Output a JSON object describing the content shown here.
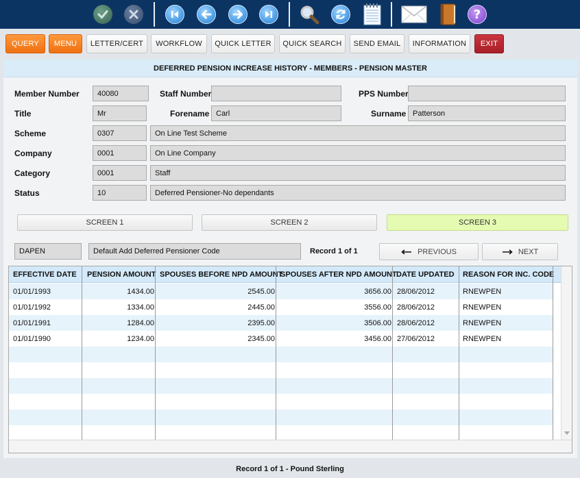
{
  "toolbar": {
    "icons": [
      "confirm-icon",
      "cancel-icon",
      "first-record-icon",
      "previous-record-icon",
      "next-record-icon",
      "last-record-icon",
      "search-icon",
      "refresh-icon",
      "notepad-icon",
      "email-icon",
      "book-icon",
      "help-icon"
    ],
    "help_glyph": "?"
  },
  "buttons": {
    "query": "QUERY",
    "menu": "MENU",
    "letter_cert": "LETTER/CERT",
    "workflow": "WORKFLOW",
    "quick_letter": "QUICK LETTER",
    "quick_search": "QUICK SEARCH",
    "send_email": "SEND EMAIL",
    "information": "INFORMATION",
    "exit": "EXIT"
  },
  "header": {
    "title": "DEFERRED PENSION INCREASE HISTORY - MEMBERS - PENSION MASTER"
  },
  "form": {
    "member_number": {
      "label": "Member Number",
      "value": "40080"
    },
    "staff_number": {
      "label": "Staff Number",
      "value": ""
    },
    "pps_number": {
      "label": "PPS Number",
      "value": ""
    },
    "title": {
      "label": "Title",
      "value": "Mr"
    },
    "forename": {
      "label": "Forename",
      "value": "Carl"
    },
    "surname": {
      "label": "Surname",
      "value": "Patterson"
    },
    "scheme": {
      "label": "Scheme",
      "code": "0307",
      "desc": "On Line Test Scheme"
    },
    "company": {
      "label": "Company",
      "code": "0001",
      "desc": "On Line Company"
    },
    "category": {
      "label": "Category",
      "code": "0001",
      "desc": "Staff"
    },
    "status": {
      "label": "Status",
      "code": "10",
      "desc": "Deferred Pensioner-No dependants"
    }
  },
  "screens": {
    "screen1": "SCREEN 1",
    "screen2": "SCREEN 2",
    "screen3": "SCREEN 3",
    "active": "screen3"
  },
  "pension_code": {
    "code": "DAPEN",
    "desc": "Default Add Deferred Pensioner Code"
  },
  "record_indicator": "Record 1 of 1",
  "nav": {
    "previous": "PREVIOUS",
    "next": "NEXT"
  },
  "table": {
    "columns": [
      "EFFECTIVE DATE",
      "PENSION AMOUNT",
      "SPOUSES BEFORE NPD AMOUNT",
      "SPOUSES AFTER NPD AMOUNT",
      "DATE UPDATED",
      "REASON FOR INC. CODE"
    ],
    "rows": [
      [
        "01/01/1993",
        "1434.00",
        "2545.00",
        "3656.00",
        "28/06/2012",
        "RNEWPEN"
      ],
      [
        "01/01/1992",
        "1334.00",
        "2445.00",
        "3556.00",
        "28/06/2012",
        "RNEWPEN"
      ],
      [
        "01/01/1991",
        "1284.00",
        "2395.00",
        "3506.00",
        "28/06/2012",
        "RNEWPEN"
      ],
      [
        "01/01/1990",
        "1234.00",
        "2345.00",
        "3456.00",
        "27/06/2012",
        "RNEWPEN"
      ]
    ],
    "empty_rows": 6
  },
  "status_bar": "Record 1 of 1 - Pound Sterling",
  "colors": {
    "toolbar_bg": "#0c3463",
    "accent_orange": "#f47c20",
    "exit_red": "#b5262f",
    "active_screen": "#e5fbb2",
    "header_blue": "#d9ecf8"
  }
}
